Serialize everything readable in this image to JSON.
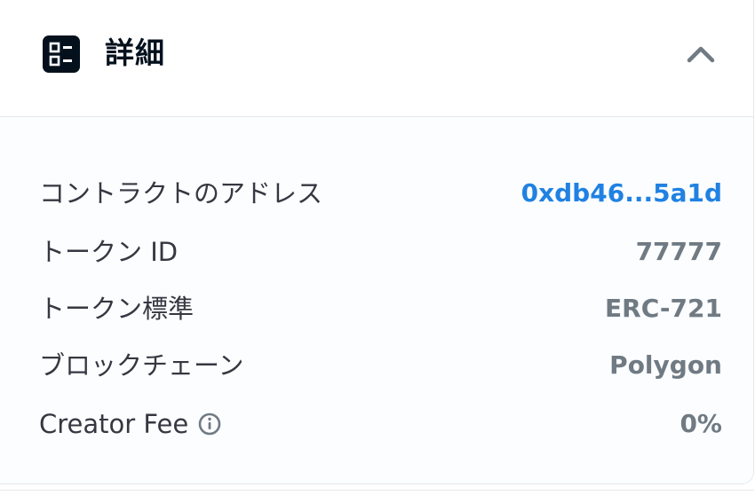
{
  "details_panel": {
    "title": "詳細",
    "icon": "detail-list-icon",
    "collapse_icon": "chevron-up-icon",
    "rows": [
      {
        "label": "コントラクトのアドレス",
        "value": "0xdb46...5a1d"
      },
      {
        "label": "トークン ID",
        "value": "77777"
      },
      {
        "label": "トークン標準",
        "value": "ERC-721"
      },
      {
        "label": "ブロックチェーン",
        "value": "Polygon"
      },
      {
        "label": "Creator Fee",
        "value": "0%"
      }
    ],
    "info_icon": "info-circle-icon"
  },
  "colors": {
    "title": "#04111d",
    "label": "#353840",
    "value": "#707a83",
    "link": "#2081e2",
    "body_background": "#fbfdff",
    "border": "#e5e8eb"
  }
}
